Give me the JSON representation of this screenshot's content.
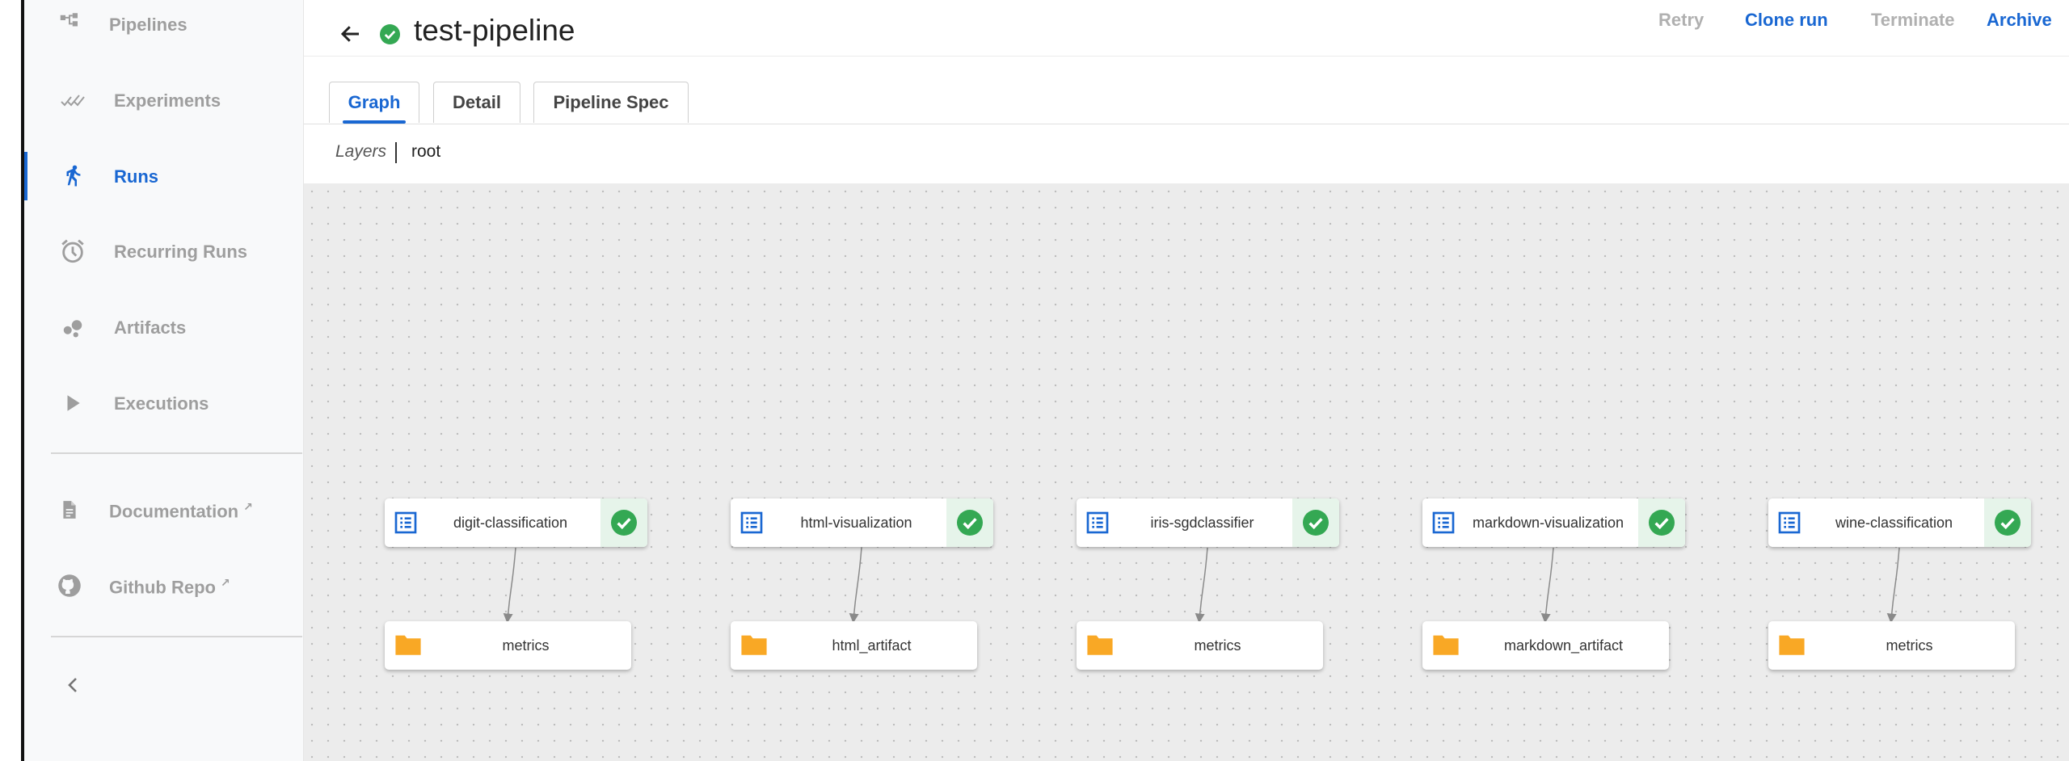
{
  "sidebar": {
    "items": [
      {
        "label": "Pipelines",
        "icon": "pipelines-icon"
      },
      {
        "label": "Experiments",
        "icon": "experiments-icon"
      },
      {
        "label": "Runs",
        "icon": "runs-icon",
        "active": true
      },
      {
        "label": "Recurring Runs",
        "icon": "alarm-icon"
      },
      {
        "label": "Artifacts",
        "icon": "artifacts-icon"
      },
      {
        "label": "Executions",
        "icon": "play-icon"
      }
    ],
    "links": [
      {
        "label": "Documentation",
        "icon": "document-icon"
      },
      {
        "label": "Github Repo",
        "icon": "github-icon"
      }
    ],
    "collapse_icon": "chevron-left-icon"
  },
  "header": {
    "title": "test-pipeline",
    "status_icon": "check-circle-icon",
    "actions": [
      {
        "label": "Retry",
        "enabled": false
      },
      {
        "label": "Clone run",
        "enabled": true
      },
      {
        "label": "Terminate",
        "enabled": false
      },
      {
        "label": "Archive",
        "enabled": true
      }
    ]
  },
  "tabs": [
    {
      "label": "Graph",
      "active": true
    },
    {
      "label": "Detail",
      "active": false
    },
    {
      "label": "Pipeline Spec",
      "active": false
    }
  ],
  "layers": {
    "label": "Layers",
    "value": "root"
  },
  "graph": {
    "tasks": [
      {
        "name": "digit-classification",
        "status": "succeeded",
        "artifact": "metrics"
      },
      {
        "name": "html-visualization",
        "status": "succeeded",
        "artifact": "html_artifact"
      },
      {
        "name": "iris-sgdclassifier",
        "status": "succeeded",
        "artifact": "metrics"
      },
      {
        "name": "markdown-visualization",
        "status": "succeeded",
        "artifact": "markdown_artifact"
      },
      {
        "name": "wine-classification",
        "status": "succeeded",
        "artifact": "metrics"
      }
    ]
  },
  "colors": {
    "accent": "#1967d2",
    "success": "#34a853",
    "artifact": "#f9a825",
    "disabled": "#b0b0b0"
  }
}
